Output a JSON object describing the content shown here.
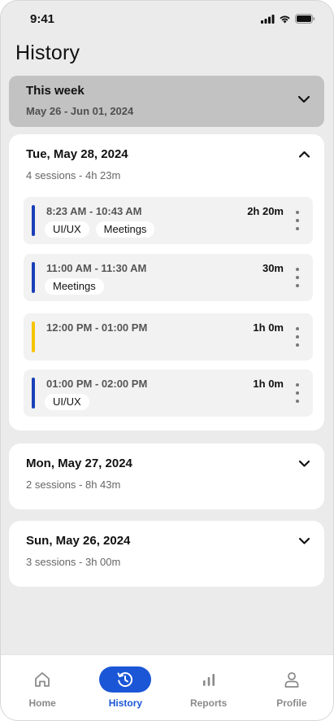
{
  "status_bar": {
    "time": "9:41"
  },
  "page": {
    "title": "History"
  },
  "week": {
    "title": "This week",
    "range": "May 26 - Jun 01, 2024"
  },
  "days": [
    {
      "title": "Tue, May 28, 2024",
      "meta": "4 sessions - 4h 23m",
      "expanded": true,
      "sessions": [
        {
          "time": "8:23 AM -  10:43 AM",
          "duration": "2h 20m",
          "color": "#1a3fb8",
          "tags": [
            "UI/UX",
            "Meetings"
          ]
        },
        {
          "time": "11:00 AM -  11:30 AM",
          "duration": "30m",
          "color": "#1a3fb8",
          "tags": [
            "Meetings"
          ]
        },
        {
          "time": "12:00 PM -  01:00 PM",
          "duration": "1h 0m",
          "color": "#f5c400",
          "tags": []
        },
        {
          "time": "01:00 PM -  02:00 PM",
          "duration": "1h 0m",
          "color": "#1a3fb8",
          "tags": [
            "UI/UX"
          ]
        }
      ]
    },
    {
      "title": "Mon, May 27, 2024",
      "meta": "2 sessions - 8h 43m",
      "expanded": false
    },
    {
      "title": "Sun, May 26, 2024",
      "meta": "3 sessions - 3h 00m",
      "expanded": false
    }
  ],
  "nav": {
    "items": [
      {
        "label": "Home",
        "icon": "home-icon",
        "active": false
      },
      {
        "label": "History",
        "icon": "history-icon",
        "active": true
      },
      {
        "label": "Reports",
        "icon": "bar-chart-icon",
        "active": false
      },
      {
        "label": "Profile",
        "icon": "profile-icon",
        "active": false
      }
    ]
  },
  "colors": {
    "accent": "#1a56d6",
    "work": "#1a3fb8",
    "break": "#f5c400"
  }
}
